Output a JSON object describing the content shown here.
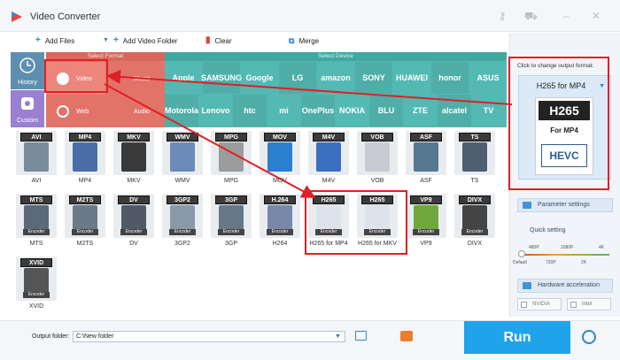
{
  "app": {
    "title": "Video Converter",
    "controls": [
      "key-icon",
      "cart-icon",
      "minimize-icon",
      "close-icon"
    ]
  },
  "toolbar": {
    "add_files": "Add Files",
    "add_video_folder": "Add Video Folder",
    "clear": "Clear",
    "merge": "Merge"
  },
  "left": {
    "history": "History",
    "custom": "Custom"
  },
  "select_format": {
    "header": "Select Format",
    "video": "Video",
    "audio": "Audio",
    "web": "Web",
    "music": "Music"
  },
  "select_device": {
    "header": "Select Device",
    "row1": [
      "Apple",
      "SAMSUNG",
      "Google",
      "LG",
      "amazon",
      "SONY",
      "HUAWEI",
      "honor",
      "ASUS"
    ],
    "row2": [
      "Motorola",
      "Lenovo",
      "htc",
      "mi",
      "OnePlus",
      "NOKIA",
      "BLU",
      "ZTE",
      "alcatel",
      "TV"
    ]
  },
  "formats": [
    {
      "badge": "AVI",
      "name": "AVI"
    },
    {
      "badge": "MP4",
      "name": "MP4"
    },
    {
      "badge": "MKV",
      "name": "MKV"
    },
    {
      "badge": "WMV",
      "name": "WMV"
    },
    {
      "badge": "MPG",
      "name": "MPG"
    },
    {
      "badge": "MOV",
      "name": "MOV"
    },
    {
      "badge": "M4V",
      "name": "M4V"
    },
    {
      "badge": "VOB",
      "name": "VOB"
    },
    {
      "badge": "ASF",
      "name": "ASF"
    },
    {
      "badge": "TS",
      "name": "TS"
    },
    {
      "badge": "MTS",
      "name": "MTS"
    },
    {
      "badge": "M2TS",
      "name": "M2TS"
    },
    {
      "badge": "DV",
      "name": "DV"
    },
    {
      "badge": "3GP2",
      "name": "3GP2"
    },
    {
      "badge": "3GP",
      "name": "3GP"
    },
    {
      "badge": "H.264",
      "name": "H264"
    },
    {
      "badge": "H265",
      "name": "H265 for MP4"
    },
    {
      "badge": "H265",
      "name": "H265 for MKV"
    },
    {
      "badge": "VP9",
      "name": "VP9"
    },
    {
      "badge": "DIVX",
      "name": "DIVX"
    },
    {
      "badge": "XVID",
      "name": "XVID"
    }
  ],
  "encoder_label": "Encoder",
  "right_panel": {
    "hint": "Click to change output format:",
    "selected": "H265 for MP4",
    "card_top": "H265",
    "card_mid": "For MP4",
    "card_bot": "HEVC",
    "parameter_settings": "Parameter settings",
    "quick_setting": "Quick setting",
    "ticks_top": [
      "480P",
      "1080P",
      "4K"
    ],
    "ticks_bottom": [
      "Default",
      "720P",
      "2K"
    ],
    "hardware_acceleration": "Hardware acceleration",
    "nvidia": "NVIDIA",
    "intel": "Intel"
  },
  "bottom": {
    "output_folder_label": "Output folder:",
    "output_folder_value": "C:\\New folder",
    "run": "Run"
  },
  "colors": {
    "format_panel": "#e27369",
    "device_panel": "#54b9b3",
    "run_button": "#1fa3ea",
    "highlight": "#e01f26"
  }
}
